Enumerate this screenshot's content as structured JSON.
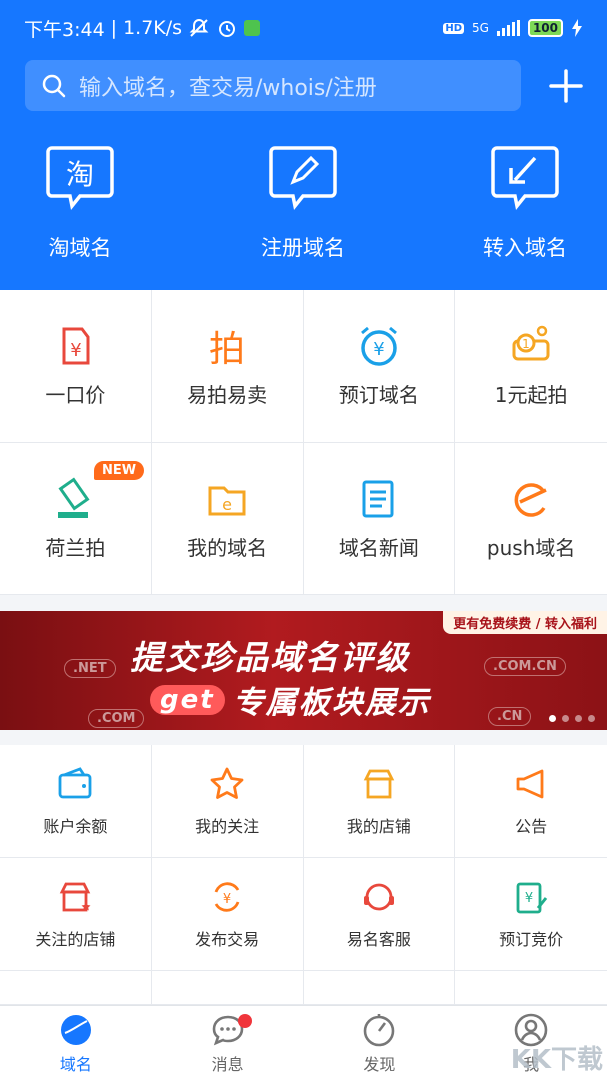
{
  "status_bar": {
    "time": "下午3:44",
    "speed": "1.7K/s",
    "hd": "HD",
    "network": "5G",
    "battery": "100"
  },
  "header": {
    "search_placeholder": "输入域名，查交易/whois/注册",
    "colors": {
      "primary": "#1677ff"
    }
  },
  "top_nav": [
    {
      "label": "淘域名",
      "icon": "tao-icon"
    },
    {
      "label": "注册域名",
      "icon": "edit-icon"
    },
    {
      "label": "转入域名",
      "icon": "transfer-in-icon"
    }
  ],
  "grid_main": [
    {
      "label": "一口价",
      "icon": "price-tag-icon"
    },
    {
      "label": "易拍易卖",
      "icon": "auction-icon"
    },
    {
      "label": "预订域名",
      "icon": "alarm-yen-icon"
    },
    {
      "label": "1元起拍",
      "icon": "one-yuan-icon"
    },
    {
      "label": "荷兰拍",
      "icon": "gavel-icon",
      "badge": "NEW"
    },
    {
      "label": "我的域名",
      "icon": "folder-e-icon"
    },
    {
      "label": "域名新闻",
      "icon": "news-icon"
    },
    {
      "label": "push域名",
      "icon": "push-icon"
    }
  ],
  "banner": {
    "top_note": "更有免费续费 / 转入福利",
    "line1": "提交珍品域名评级",
    "get": "get",
    "line2": "专属板块展示",
    "tags": [
      ".NET",
      ".COM",
      ".COM.CN",
      ".CN"
    ],
    "slides": 4,
    "active_slide": 1
  },
  "grid_tools": [
    {
      "label": "账户余额",
      "icon": "wallet-icon"
    },
    {
      "label": "我的关注",
      "icon": "star-icon"
    },
    {
      "label": "我的店铺",
      "icon": "shop-icon"
    },
    {
      "label": "公告",
      "icon": "megaphone-icon"
    },
    {
      "label": "关注的店铺",
      "icon": "followed-shop-icon"
    },
    {
      "label": "发布交易",
      "icon": "publish-trade-icon"
    },
    {
      "label": "易名客服",
      "icon": "headset-icon"
    },
    {
      "label": "预订竞价",
      "icon": "bid-icon"
    }
  ],
  "tabbar": [
    {
      "label": "域名",
      "icon": "domain-tab-icon",
      "active": true
    },
    {
      "label": "消息",
      "icon": "message-icon",
      "badge": true
    },
    {
      "label": "发现",
      "icon": "compass-icon"
    },
    {
      "label": "我",
      "icon": "profile-icon"
    }
  ],
  "watermark": "KK下载"
}
